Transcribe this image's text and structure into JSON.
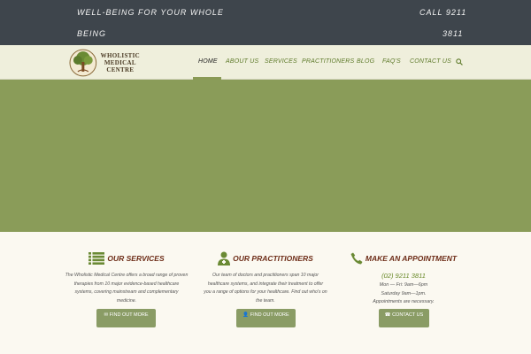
{
  "topbar": {
    "tagline_line1": "WELL-BEING FOR YOUR WHOLE",
    "tagline_line2": "BEING",
    "phone_line1": "CALL 9211",
    "phone_line2": "3811"
  },
  "logo": {
    "line1": "WHOLISTIC",
    "line2": "MEDICAL",
    "line3": "CENTRE"
  },
  "nav": {
    "items": [
      "HOME",
      "ABOUT US",
      "SERVICES",
      "PRACTITIONERS",
      "BLOG",
      "FAQ'S",
      "CONTACT US"
    ],
    "active": "HOME"
  },
  "colors": {
    "topbar": "#3e454c",
    "header": "#efefdc",
    "hero": "#8a9c59",
    "accent_title": "#6d2c17",
    "button": "#8a9c65",
    "link_green": "#5e7a2a"
  },
  "features": {
    "services": {
      "icon": "list-icon",
      "title": "OUR SERVICES",
      "body": "The Wholistic Medical Centre offers a broad range of proven therapies from 10 major evidence-based healthcare systems, covering mainstream and complementary medicine.",
      "button": "FIND OUT MORE"
    },
    "practitioners": {
      "icon": "doctor-icon",
      "title": "OUR PRACTITIONERS",
      "body": "Our team of doctors and practitioners span 10 major healthcare systems, and integrate their treatment to offer you a range of options for your healthcare. Find out who's on the team.",
      "button": "FIND OUT MORE"
    },
    "appointment": {
      "icon": "phone-icon",
      "title": "MAKE AN APPOINTMENT",
      "phone": "(02) 9211 3811",
      "hours1": "Mon — Fri: 9am—6pm",
      "hours2": "Saturday 9am—1pm.",
      "note": "Appointments are necessary.",
      "button": "CONTACT US"
    }
  }
}
